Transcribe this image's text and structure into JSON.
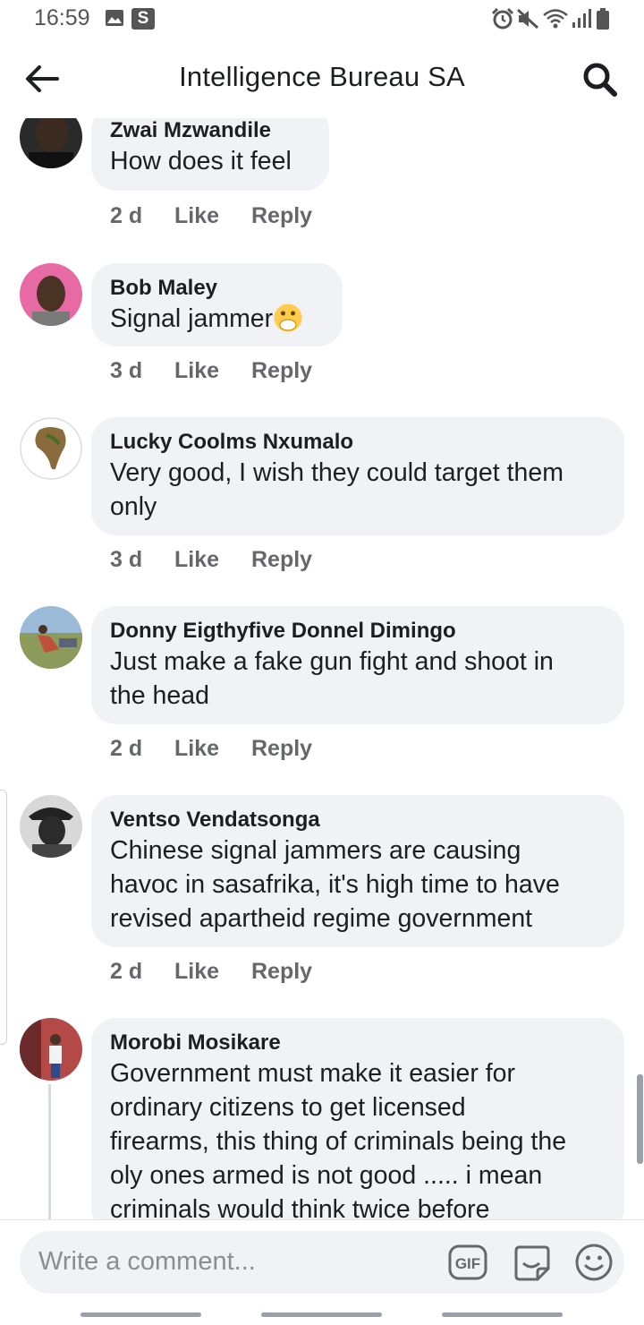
{
  "status_bar": {
    "time": "16:59",
    "left_icons": [
      "image-icon",
      "s-badge-icon"
    ],
    "s_badge": "S",
    "right_icons": [
      "alarm-icon",
      "mute-icon",
      "wifi-icon",
      "signal-icon",
      "battery-icon"
    ]
  },
  "header": {
    "title": "Intelligence Bureau SA",
    "back_icon": "arrow-left-icon",
    "search_icon": "search-icon"
  },
  "actions": {
    "like_label": "Like",
    "reply_label": "Reply"
  },
  "comments": [
    {
      "author": "Zwai Mzwandile",
      "lines": [
        "How does it feel"
      ],
      "time": "2 d"
    },
    {
      "author": "Bob Maley",
      "lines": [
        "Signal jammer"
      ],
      "emoji": "face-with-hand-over-mouth",
      "time": "3 d"
    },
    {
      "author": "Lucky Coolms Nxumalo",
      "lines": [
        "Very good, I wish they could target them",
        "only"
      ],
      "time": "3 d"
    },
    {
      "author": "Donny Eigthyfive Donnel Dimingo",
      "lines": [
        "Just make a fake gun fight and shoot in",
        "the head"
      ],
      "time": "2 d"
    },
    {
      "author": "Ventso Vendatsonga",
      "lines": [
        "Chinese signal jammers are causing",
        "havoc in sasafrika, it's high time to have",
        "revised apartheid regime government"
      ],
      "time": "2 d"
    },
    {
      "author": "Morobi Mosikare",
      "lines": [
        "Government must make it easier for",
        "ordinary citizens to get licensed",
        "firearms, this thing of criminals being the",
        "oly ones armed is not good  ..... i mean",
        "criminals would think twice before"
      ]
    }
  ],
  "composer": {
    "placeholder": "Write a comment...",
    "gif_label": "GIF",
    "icons": [
      "gif-icon",
      "sticker-icon",
      "emoji-icon"
    ]
  },
  "colors": {
    "bubble": "#f0f2f5",
    "meta_text": "#65676b",
    "text": "#1c1e21"
  }
}
